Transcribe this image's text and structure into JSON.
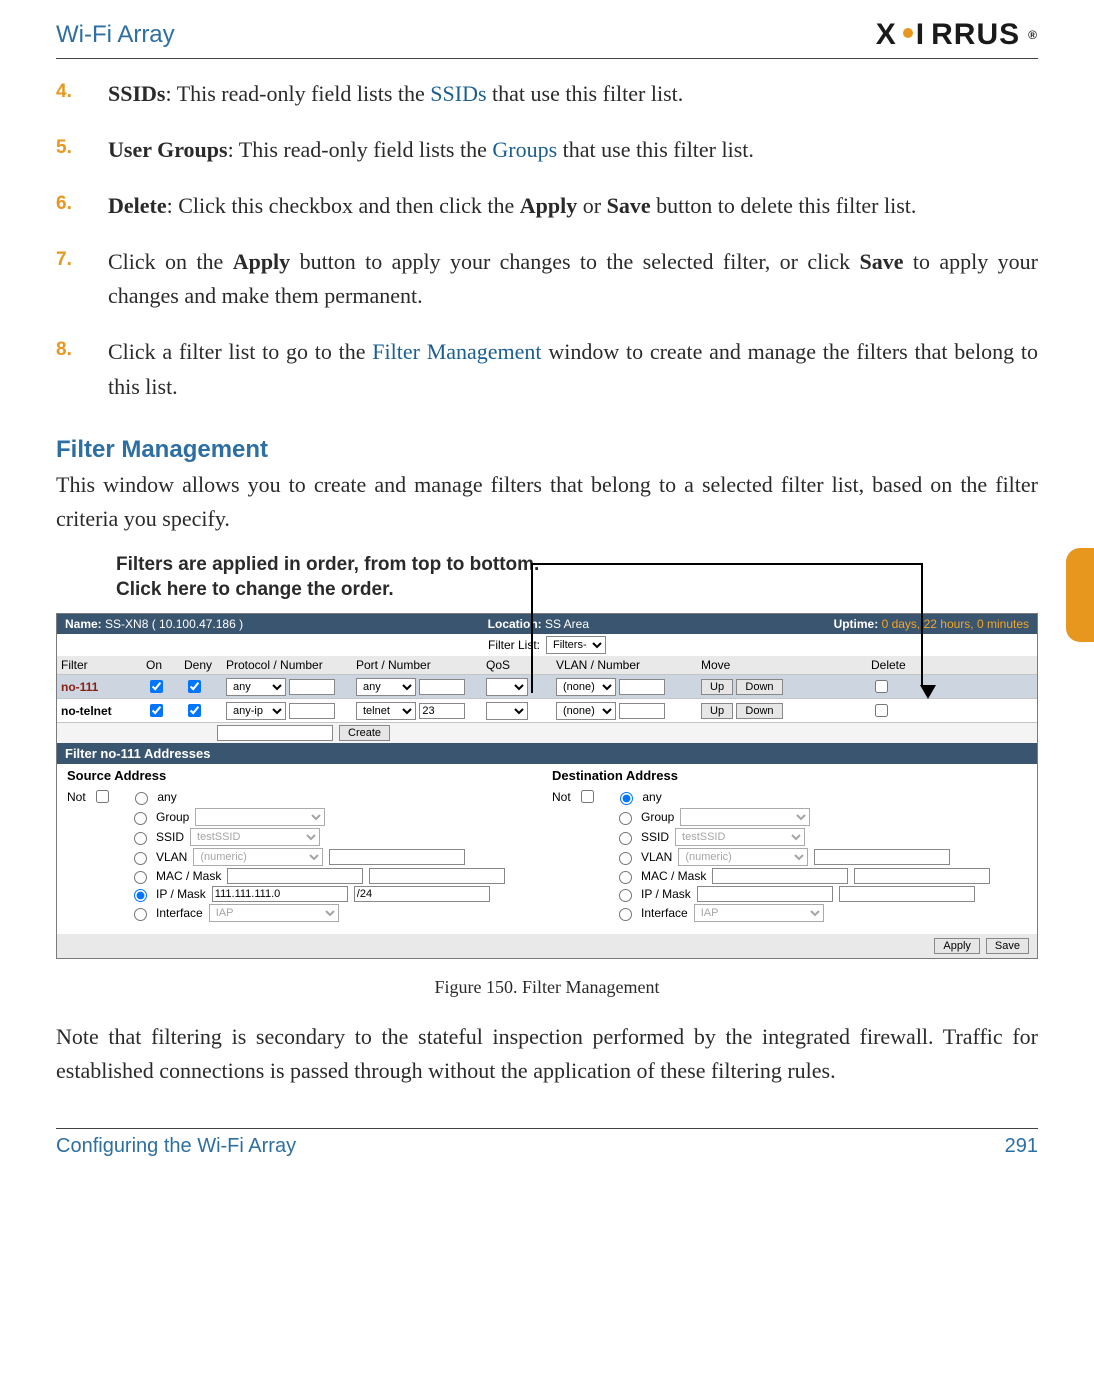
{
  "header": {
    "title": "Wi-Fi Array",
    "logo_text": "XIRRUS",
    "logo_reg": "®"
  },
  "steps": [
    {
      "n": "4.",
      "lead": "SSIDs",
      "body_a": ": This read-only field lists the ",
      "link": "SSIDs",
      "body_b": " that use this filter list."
    },
    {
      "n": "5.",
      "lead": "User Groups",
      "body_a": ": This read-only field lists the ",
      "link": "Groups",
      "body_b": " that use this filter list."
    },
    {
      "n": "6.",
      "lead": "Delete",
      "body_a": ": Click this checkbox and then click the ",
      "b1": "Apply",
      "mid": " or ",
      "b2": "Save",
      "body_b": " button to delete this filter list."
    },
    {
      "n": "7.",
      "body_a": "Click on the ",
      "b1": "Apply",
      "mid1": " button to apply your changes to the selected filter, or click ",
      "b2": "Save",
      "body_b": " to apply your changes and make them permanent."
    },
    {
      "n": "8.",
      "body_a": "Click a filter list to go to the ",
      "link": "Filter Management",
      "body_b": " window to create and manage the filters that belong to this list."
    }
  ],
  "section": {
    "heading": "Filter Management",
    "intro": "This window allows you to create and manage filters that belong to a selected filter list, based on the filter criteria you specify.",
    "callout_l1": "Filters are applied in order, from top to bottom.",
    "callout_l2": "Click here to change the order.",
    "caption": "Figure 150. Filter Management",
    "note": "Note that filtering is secondary to the stateful inspection performed by the integrated firewall. Traffic for established connections is passed through without the application of these filtering rules."
  },
  "shot": {
    "name_lbl": "Name:",
    "name_val": "SS-XN8   ( 10.100.47.186 )",
    "loc_lbl": "Location:",
    "loc_val": "SS Area",
    "up_lbl": "Uptime:",
    "up_val": "0 days, 22 hours, 0 minutes",
    "filter_list_lbl": "Filter List:",
    "filter_list_val": "Filters-A",
    "cols": {
      "filter": "Filter",
      "on": "On",
      "deny": "Deny",
      "proto": "Protocol / Number",
      "port": "Port / Number",
      "qos": "QoS",
      "vlan": "VLAN / Number",
      "move": "Move",
      "del": "Delete"
    },
    "rows": [
      {
        "sel": true,
        "name": "no-111",
        "on": true,
        "deny": true,
        "proto": "any",
        "pnum": "",
        "port": "any",
        "portnum": "",
        "qos": "",
        "vlan": "(none)",
        "vnum": "",
        "up": "Up",
        "down": "Down"
      },
      {
        "sel": false,
        "name": "no-telnet",
        "on": true,
        "deny": true,
        "proto": "any-ip",
        "pnum": "",
        "port": "telnet",
        "portnum": "23",
        "qos": "",
        "vlan": "(none)",
        "vnum": "",
        "up": "Up",
        "down": "Down"
      }
    ],
    "create_btn": "Create",
    "addr_bar": "Filter no-111  Addresses",
    "src": {
      "title": "Source Address",
      "not": "Not",
      "opts": {
        "any": "any",
        "group": "Group",
        "ssid": "SSID",
        "vlan": "VLAN",
        "mac": "MAC / Mask",
        "ip": "IP / Mask",
        "iface": "Interface"
      },
      "ssid_ph": "testSSID",
      "vlan_ph": "(numeric)",
      "ip_val": "111.111.111.0",
      "mask_val": "/24",
      "iface_ph": "IAP",
      "selected": "ip"
    },
    "dst": {
      "title": "Destination Address",
      "not": "Not",
      "opts": {
        "any": "any",
        "group": "Group",
        "ssid": "SSID",
        "vlan": "VLAN",
        "mac": "MAC / Mask",
        "ip": "IP / Mask",
        "iface": "Interface"
      },
      "ssid_ph": "testSSID",
      "vlan_ph": "(numeric)",
      "iface_ph": "IAP",
      "selected": "any"
    },
    "apply_btn": "Apply",
    "save_btn": "Save"
  },
  "footer": {
    "left": "Configuring the Wi-Fi Array",
    "right": "291"
  }
}
